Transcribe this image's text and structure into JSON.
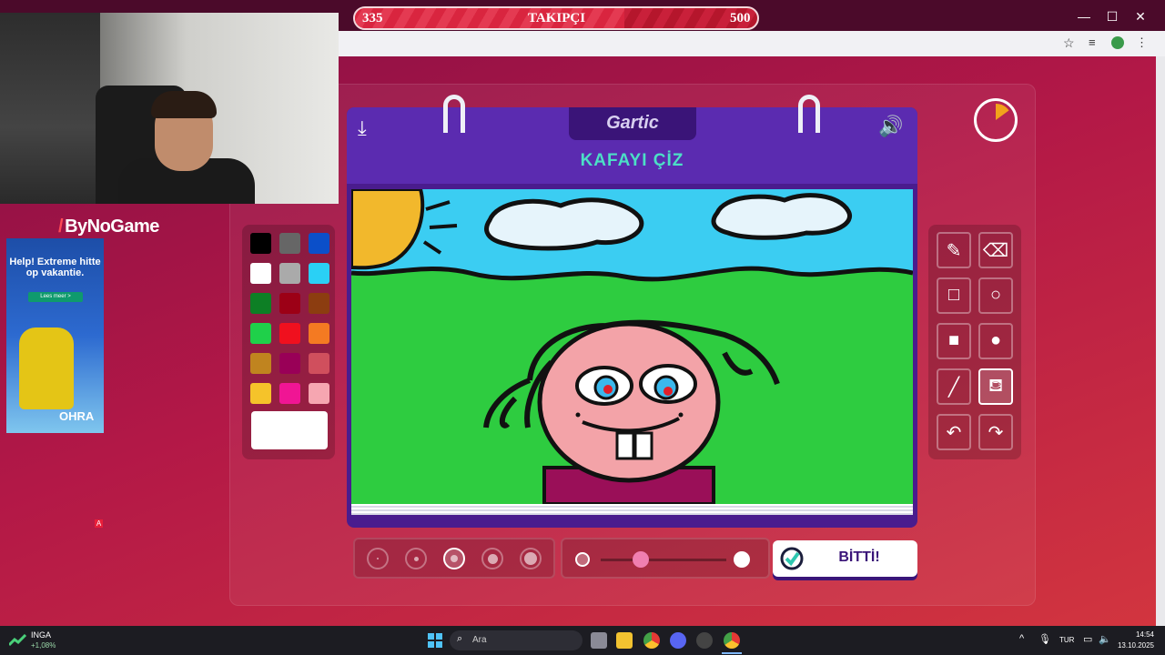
{
  "follower_bar": {
    "current": "335",
    "label": "TAKIPÇI",
    "goal": "500",
    "progress": 0.67
  },
  "brand": {
    "name": "ByNoGame"
  },
  "ad": {
    "title": "Help! Extreme hitte op vakantie.",
    "button": "Lees meer >",
    "brand": "OHRA"
  },
  "game": {
    "logo": "Gartic",
    "prompt": "KAFAYI ÇİZ",
    "done_label": "BİTTİ!"
  },
  "palette": {
    "colors": [
      "#000000",
      "#666666",
      "#0b4fc9",
      "#ffffff",
      "#aaaaaa",
      "#2ad0f5",
      "#0d7f25",
      "#9c0016",
      "#8c3d10",
      "#1fd04a",
      "#f0101e",
      "#f47a22",
      "#c0841f",
      "#990057",
      "#d04f5d",
      "#f5c32a",
      "#f01594",
      "#f6a6b1"
    ],
    "current": "#ffffff"
  },
  "tools": {
    "items": [
      "pencil-icon",
      "eraser-icon",
      "rectangle-outline-icon",
      "circle-outline-icon",
      "rectangle-fill-icon",
      "circle-fill-icon",
      "line-icon",
      "fill-bucket-icon",
      "undo-icon",
      "redo-icon"
    ],
    "active": "fill-bucket-icon"
  },
  "brush_sizes": {
    "count": 5,
    "selected_index": 2
  },
  "opacity": {
    "value": 0.32
  },
  "timer": {
    "remaining_fraction": 0.85
  },
  "taskbar": {
    "stock_name": "INGA",
    "stock_change": "+1,08%",
    "search_placeholder": "Ara",
    "lang": "TUR",
    "time": "14:54",
    "date": "13.10.2025"
  }
}
